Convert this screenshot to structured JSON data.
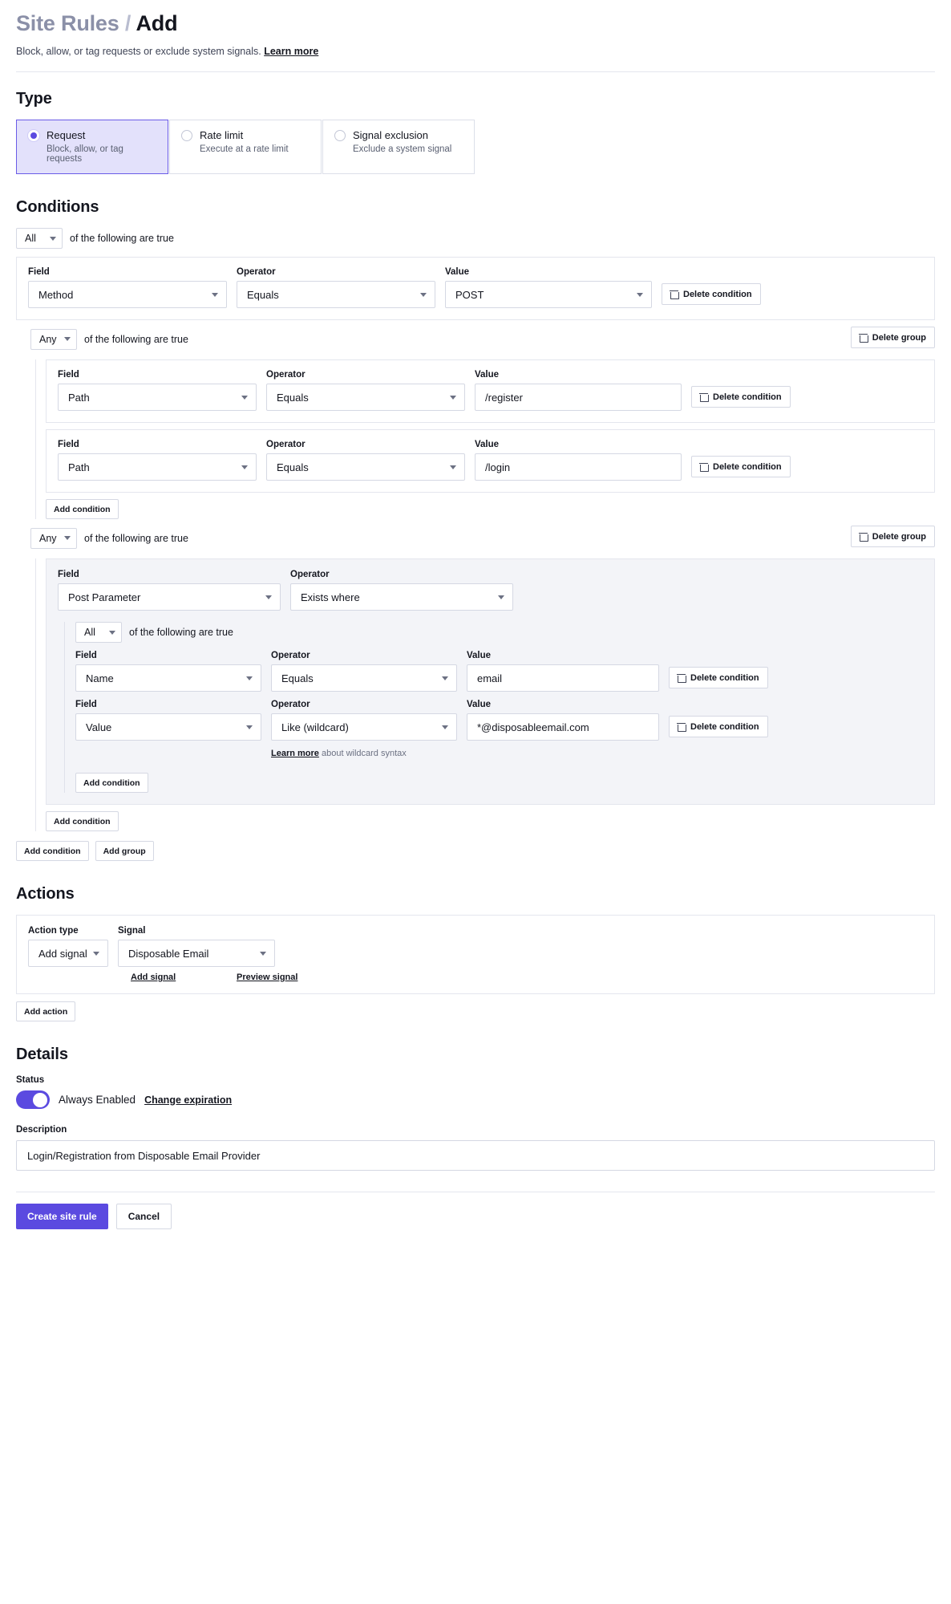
{
  "header": {
    "breadcrumb_parent": "Site Rules",
    "separator": "/",
    "breadcrumb_current": "Add",
    "subtitle": "Block, allow, or tag requests or exclude system signals.",
    "learn_more": "Learn more"
  },
  "type": {
    "section_title": "Type",
    "options": [
      {
        "label": "Request",
        "desc": "Block, allow, or tag requests",
        "selected": true
      },
      {
        "label": "Rate limit",
        "desc": "Execute at a rate limit",
        "selected": false
      },
      {
        "label": "Signal exclusion",
        "desc": "Exclude a system signal",
        "selected": false
      }
    ]
  },
  "conditions": {
    "section_title": "Conditions",
    "root_boolean": "All",
    "boolean_suffix": "of the following are true",
    "labels": {
      "field": "Field",
      "operator": "Operator",
      "value": "Value"
    },
    "root_condition": {
      "field": "Method",
      "operator": "Equals",
      "value": "POST",
      "delete_label": "Delete condition"
    },
    "group_path": {
      "boolean": "Any",
      "boolean_suffix": "of the following are true",
      "delete_group_label": "Delete group",
      "add_condition_label": "Add condition",
      "conditions": [
        {
          "field": "Path",
          "operator": "Equals",
          "value": "/register",
          "delete_label": "Delete condition"
        },
        {
          "field": "Path",
          "operator": "Equals",
          "value": "/login",
          "delete_label": "Delete condition"
        }
      ]
    },
    "group_postparam": {
      "boolean": "Any",
      "boolean_suffix": "of the following are true",
      "delete_group_label": "Delete group",
      "add_condition_label": "Add condition",
      "parent": {
        "field": "Post Parameter",
        "operator": "Exists where"
      },
      "inner_boolean": "All",
      "inner_boolean_suffix": "of the following are true",
      "inner_add_condition_label": "Add condition",
      "inner_conditions": [
        {
          "field": "Name",
          "operator": "Equals",
          "value": "email",
          "delete_label": "Delete condition"
        },
        {
          "field": "Value",
          "operator": "Like (wildcard)",
          "value": "*@disposableemail.com",
          "delete_label": "Delete condition"
        }
      ],
      "wildcard_hint_link": "Learn more",
      "wildcard_hint_text": "about wildcard syntax"
    },
    "footer_buttons": {
      "add_condition": "Add condition",
      "add_group": "Add group"
    }
  },
  "actions": {
    "section_title": "Actions",
    "labels": {
      "action_type": "Action type",
      "signal": "Signal"
    },
    "action_type_value": "Add signal",
    "signal_value": "Disposable Email",
    "add_signal_link": "Add signal",
    "preview_signal_link": "Preview signal",
    "add_action_label": "Add action"
  },
  "details": {
    "section_title": "Details",
    "status_label": "Status",
    "status_text": "Always Enabled",
    "change_expiration_link": "Change expiration",
    "status_enabled": true,
    "description_label": "Description",
    "description_value": "Login/Registration from Disposable Email Provider"
  },
  "footer": {
    "primary": "Create site rule",
    "secondary": "Cancel"
  },
  "colors": {
    "accent": "#5b4ae0",
    "selected_card_bg": "#e3e1fb",
    "border": "#e4e6ee",
    "shaded_bg": "#f3f4f8"
  }
}
